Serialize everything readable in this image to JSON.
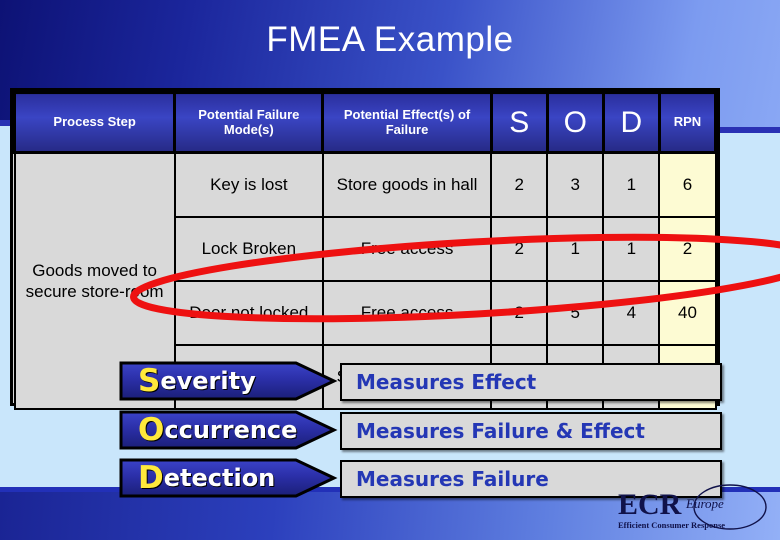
{
  "slide": {
    "title": "FMEA Example",
    "background_colors": {
      "top_blue": "#1b269c",
      "panel_light_blue": "#c9e6fb",
      "band_blue": "#2a31b4",
      "accent_red": "#ee1111",
      "header_blue": "#2b2f9e",
      "rpn_yellow": "#fdfbd3",
      "cell_gray": "#d9d9d9",
      "callout_yellow": "#ffe93b",
      "definition_text_blue": "#2437b5"
    }
  },
  "table": {
    "headers": [
      "Process Step",
      "Potential Failure Mode(s)",
      "Potential Effect(s) of Failure",
      "S",
      "O",
      "D",
      "RPN"
    ],
    "process_step": "Goods moved to secure store-room",
    "rows": [
      {
        "failure_mode": "Key is lost",
        "effect": "Store goods in hall",
        "s": "2",
        "o": "3",
        "d": "1",
        "rpn": "6"
      },
      {
        "failure_mode": "Lock Broken",
        "effect": "Free access",
        "s": "2",
        "o": "1",
        "d": "1",
        "rpn": "2"
      },
      {
        "failure_mode": "Door not locked",
        "effect": "Free access",
        "s": "2",
        "o": "5",
        "d": "4",
        "rpn": "40"
      },
      {
        "failure_mode": "",
        "effect": "Store goods in hall",
        "s": "",
        "o": "",
        "d": "",
        "rpn": ""
      }
    ]
  },
  "callouts": [
    {
      "initial": "S",
      "rest": "everity",
      "definition": "Measures Effect"
    },
    {
      "initial": "O",
      "rest": "ccurrence",
      "definition": "Measures Failure & Effect"
    },
    {
      "initial": "D",
      "rest": "etection",
      "definition": "Measures Failure"
    }
  ],
  "logo": {
    "main": "ECR",
    "sub": "Europe",
    "tagline": "Efficient Consumer Response"
  }
}
